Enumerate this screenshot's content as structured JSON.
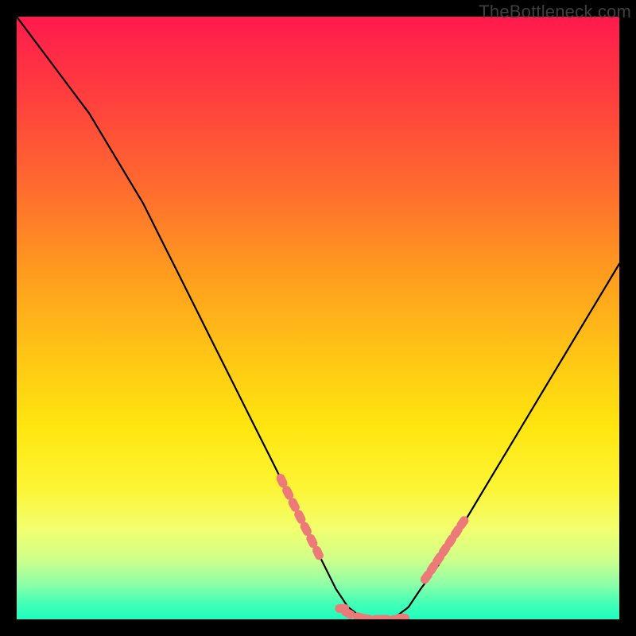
{
  "watermark": "TheBottleneck.com",
  "colors": {
    "background": "#000000",
    "curve_stroke": "#000000",
    "marker_fill": "#ec7a78",
    "gradient_top": "#ff1a4d",
    "gradient_bottom": "#1affc0",
    "watermark_text": "#3f3f3f"
  },
  "chart_data": {
    "type": "line",
    "title": "",
    "xlabel": "",
    "ylabel": "",
    "xlim": [
      0,
      100
    ],
    "ylim": [
      0,
      100
    ],
    "grid": false,
    "legend": false,
    "series": [
      {
        "name": "bottleneck-curve",
        "x": [
          0,
          3,
          6,
          9,
          12,
          15,
          18,
          21,
          24,
          27,
          30,
          33,
          36,
          39,
          42,
          45,
          48,
          51,
          53,
          55,
          57,
          59,
          61,
          63,
          65,
          67,
          70,
          73,
          76,
          79,
          82,
          85,
          88,
          91,
          94,
          97,
          100
        ],
        "y": [
          100,
          96,
          92,
          88,
          84,
          79,
          74,
          69,
          63,
          57,
          51,
          45,
          39,
          33,
          27,
          21,
          15,
          9,
          5,
          2,
          0.5,
          0,
          0,
          0.5,
          2,
          5,
          9,
          14,
          19,
          24,
          29,
          34,
          39,
          44,
          49,
          54,
          59
        ]
      }
    ],
    "flat_region_x": [
      57,
      65
    ],
    "markers": {
      "name": "highlighted-segments",
      "left_wall": {
        "x": [
          44,
          45,
          46,
          47,
          48,
          49,
          50
        ],
        "y": [
          23,
          21,
          19,
          17,
          15,
          13,
          11
        ]
      },
      "valley": {
        "x": [
          54,
          55,
          57,
          58,
          60,
          61,
          63,
          64
        ],
        "y": [
          1.8,
          1.0,
          0.3,
          0.1,
          0.0,
          0.0,
          0.0,
          0.2
        ]
      },
      "right_wall": {
        "x": [
          68,
          69,
          70,
          71,
          72,
          73,
          74
        ],
        "y": [
          7,
          8.5,
          10,
          11.5,
          13,
          14.5,
          16
        ]
      }
    }
  }
}
